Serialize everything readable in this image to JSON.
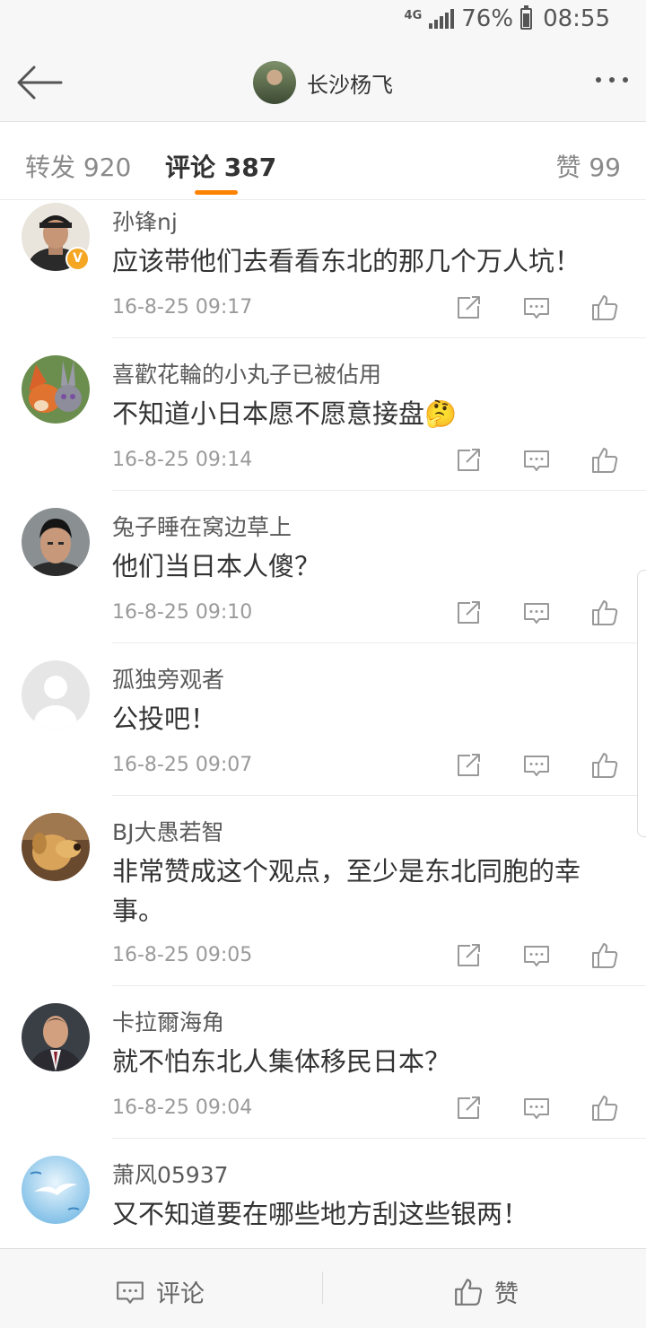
{
  "status_bar": {
    "network": "4G",
    "battery": "76%",
    "time": "08:55"
  },
  "header": {
    "title": "长沙杨飞"
  },
  "tabs": {
    "reposts": "转发 920",
    "comments": "评论 387",
    "likes": "赞 99"
  },
  "comments": [
    {
      "username": "孙锋nj",
      "text": "应该带他们去看看东北的那几个万人坑！",
      "time": "16-8-25 09:17",
      "verified": true
    },
    {
      "username": "喜歡花輪的小丸子已被佔用",
      "text": "不知道小日本愿不愿意接盘🤔",
      "time": "16-8-25 09:14"
    },
    {
      "username": "兔子睡在窝边草上",
      "text": "他们当日本人傻？",
      "time": "16-8-25 09:10"
    },
    {
      "username": "孤独旁观者",
      "text": "公投吧！",
      "time": "16-8-25 09:07"
    },
    {
      "username": "BJ大愚若智",
      "text": "非常赞成这个观点，至少是东北同胞的幸事。",
      "time": "16-8-25 09:05"
    },
    {
      "username": "卡拉爾海角",
      "text": "就不怕东北人集体移民日本？",
      "time": "16-8-25 09:04"
    },
    {
      "username": "萧风05937",
      "text": "又不知道要在哪些地方刮这些银两！"
    }
  ],
  "bottom_bar": {
    "comment": "评论",
    "like": "赞"
  },
  "colors": {
    "accent": "#ff8200",
    "verified_badge": "#f5a623"
  }
}
